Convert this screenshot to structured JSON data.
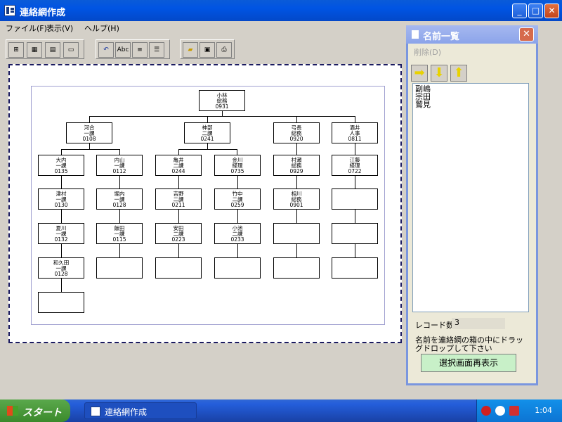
{
  "window": {
    "title": "連絡網作成",
    "minimize": "_",
    "maximize": "□",
    "close": "✕"
  },
  "menu": [
    "ファイル(F)",
    "表示(V)",
    "ヘルプ(H)"
  ],
  "toolbar": {
    "abc_label": "Abc"
  },
  "org_nodes": [
    {
      "name": "小林",
      "dept": "総務",
      "code": "0931"
    },
    {
      "name": "河合",
      "dept": "一課",
      "code": "0108"
    },
    {
      "name": "神部",
      "dept": "二課",
      "code": "0241"
    },
    {
      "name": "弓長",
      "dept": "総務",
      "code": "0920"
    },
    {
      "name": "酒井",
      "dept": "人事",
      "code": "0811"
    },
    {
      "name": "大内",
      "dept": "一課",
      "code": "0135"
    },
    {
      "name": "内山",
      "dept": "一課",
      "code": "0112"
    },
    {
      "name": "亀井",
      "dept": "二課",
      "code": "0244"
    },
    {
      "name": "金川",
      "dept": "経理",
      "code": "0735"
    },
    {
      "name": "村瀬",
      "dept": "総務",
      "code": "0929"
    },
    {
      "name": "江藤",
      "dept": "経理",
      "code": "0722"
    },
    {
      "name": "津村",
      "dept": "一課",
      "code": "0130"
    },
    {
      "name": "堀内",
      "dept": "一課",
      "code": "0128"
    },
    {
      "name": "吉野",
      "dept": "二課",
      "code": "0211"
    },
    {
      "name": "竹中",
      "dept": "二課",
      "code": "0259"
    },
    {
      "name": "相川",
      "dept": "総務",
      "code": "0901"
    },
    {
      "name": "",
      "dept": "",
      "code": ""
    },
    {
      "name": "夏川",
      "dept": "一課",
      "code": "0132"
    },
    {
      "name": "飯田",
      "dept": "一課",
      "code": "0115"
    },
    {
      "name": "安田",
      "dept": "二課",
      "code": "0223"
    },
    {
      "name": "小池",
      "dept": "二課",
      "code": "0233"
    },
    {
      "name": "",
      "dept": "",
      "code": ""
    },
    {
      "name": "",
      "dept": "",
      "code": ""
    },
    {
      "name": "和久田",
      "dept": "一課",
      "code": "0128"
    },
    {
      "name": "",
      "dept": "",
      "code": ""
    },
    {
      "name": "",
      "dept": "",
      "code": ""
    },
    {
      "name": "",
      "dept": "",
      "code": ""
    },
    {
      "name": "",
      "dept": "",
      "code": ""
    },
    {
      "name": "",
      "dept": "",
      "code": ""
    },
    {
      "name": "",
      "dept": "",
      "code": ""
    }
  ],
  "name_panel": {
    "title": "名前一覧",
    "close": "✕",
    "menu_delete": "削除(D)",
    "names": [
      "副嶋",
      "宗田",
      "鷲見"
    ],
    "record_label": "レコード数=",
    "record_count": "3",
    "help_text": "名前を連絡網の箱の中にドラッグドロップして下さい",
    "redisplay_button": "選択画面再表示"
  },
  "taskbar": {
    "start_label": "スタート",
    "task_label": "連絡網作成",
    "clock": "1:04"
  }
}
